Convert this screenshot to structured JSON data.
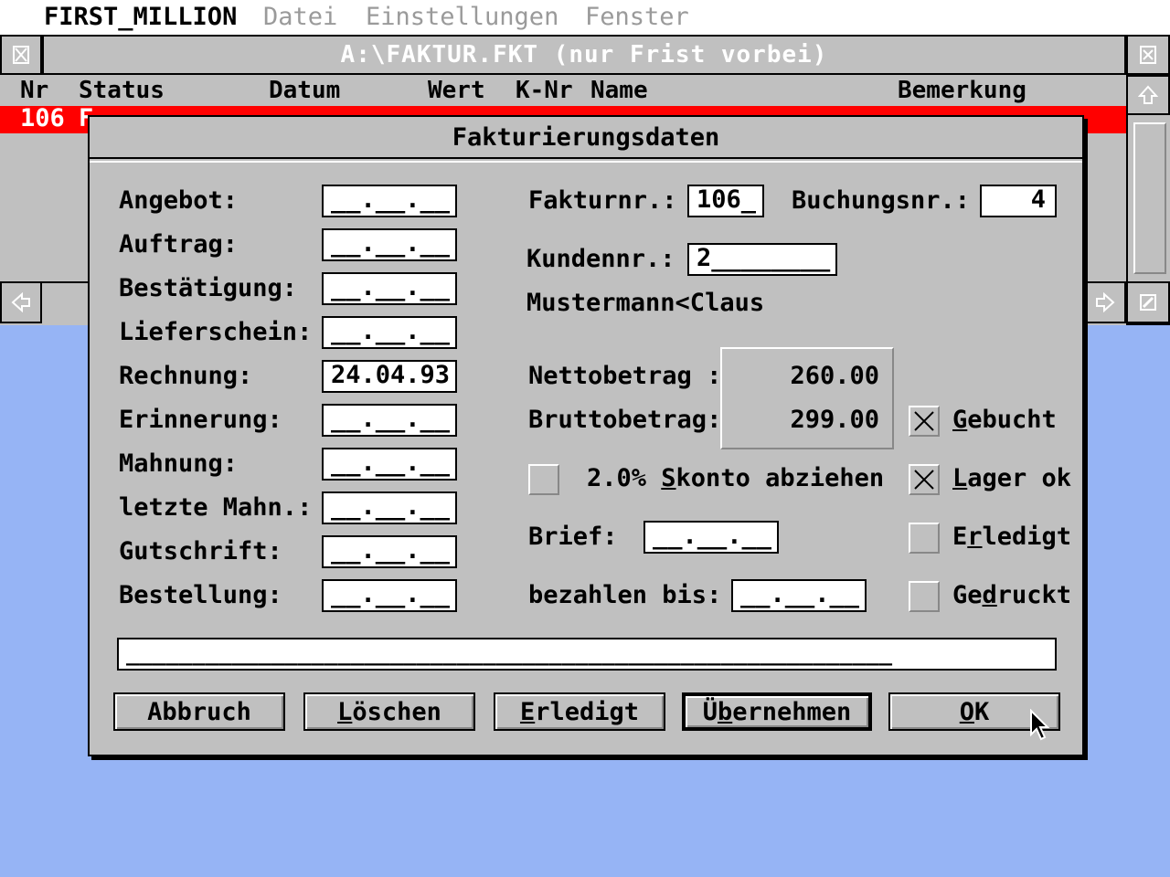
{
  "menubar": {
    "app": "FIRST_MILLION",
    "items": [
      "Datei",
      "Einstellungen",
      "Fenster"
    ]
  },
  "window": {
    "title": "A:\\FAKTUR.FKT (nur Frist vorbei)",
    "columns": [
      "Nr",
      "Status",
      "Datum",
      "Wert",
      "K-Nr",
      "Name",
      "Bemerkung"
    ],
    "selected_row": {
      "nr": "106",
      "status": "F"
    }
  },
  "dialog": {
    "title": "Fakturierungsdaten",
    "date_fields": [
      {
        "label": "Angebot:",
        "value": "__.__.__"
      },
      {
        "label": "Auftrag:",
        "value": "__.__.__"
      },
      {
        "label": "Bestätigung:",
        "value": "__.__.__"
      },
      {
        "label": "Lieferschein:",
        "value": "__.__.__"
      },
      {
        "label": "Rechnung:",
        "value": "24.04.93"
      },
      {
        "label": "Erinnerung:",
        "value": "__.__.__"
      },
      {
        "label": "Mahnung:",
        "value": "__.__.__"
      },
      {
        "label": "letzte Mahn.:",
        "value": "__.__.__"
      },
      {
        "label": "Gutschrift:",
        "value": "__.__.__"
      },
      {
        "label": "Bestellung:",
        "value": "__.__.__"
      }
    ],
    "fakturnr": {
      "label": "Fakturnr.:",
      "value": "106_"
    },
    "buchungsnr": {
      "label": "Buchungsnr.:",
      "value": "4"
    },
    "kundennr": {
      "label": "Kundennr.:",
      "value": "2________"
    },
    "customer_name": "Mustermann<Claus",
    "netto": {
      "label": "Nettobetrag :",
      "value": "260.00"
    },
    "brutto": {
      "label": "Bruttobetrag:",
      "value": "299.00"
    },
    "skonto": {
      "prefix": "2.0% ",
      "mnemonic": "S",
      "rest": "konto abziehen",
      "checked": false
    },
    "brief": {
      "label": "Brief:",
      "value": "__.__.__"
    },
    "bezahlen": {
      "label": "bezahlen bis:",
      "value": "__.__.__"
    },
    "checkboxes": [
      {
        "pre": "",
        "mn": "G",
        "post": "ebucht",
        "checked": true
      },
      {
        "pre": "",
        "mn": "L",
        "post": "ager ok",
        "checked": true
      },
      {
        "pre": "E",
        "mn": "r",
        "post": "ledigt",
        "checked": false
      },
      {
        "pre": "Ge",
        "mn": "d",
        "post": "ruckt",
        "checked": false
      }
    ],
    "remark": "__________________________________________________________",
    "buttons": {
      "abbruch": "Abbruch",
      "loeschen_mn": "L",
      "loeschen_rest": "öschen",
      "erledigt_mn": "E",
      "erledigt_rest": "rledigt",
      "uebernehmen_pre": "Ü",
      "uebernehmen_mn": "b",
      "uebernehmen_rest": "ernehmen",
      "ok_mn": "O",
      "ok_rest": "K"
    }
  },
  "colors": {
    "desktop": "#96b4f5",
    "selection": "#ff0000",
    "window": "#c0c0c0"
  }
}
